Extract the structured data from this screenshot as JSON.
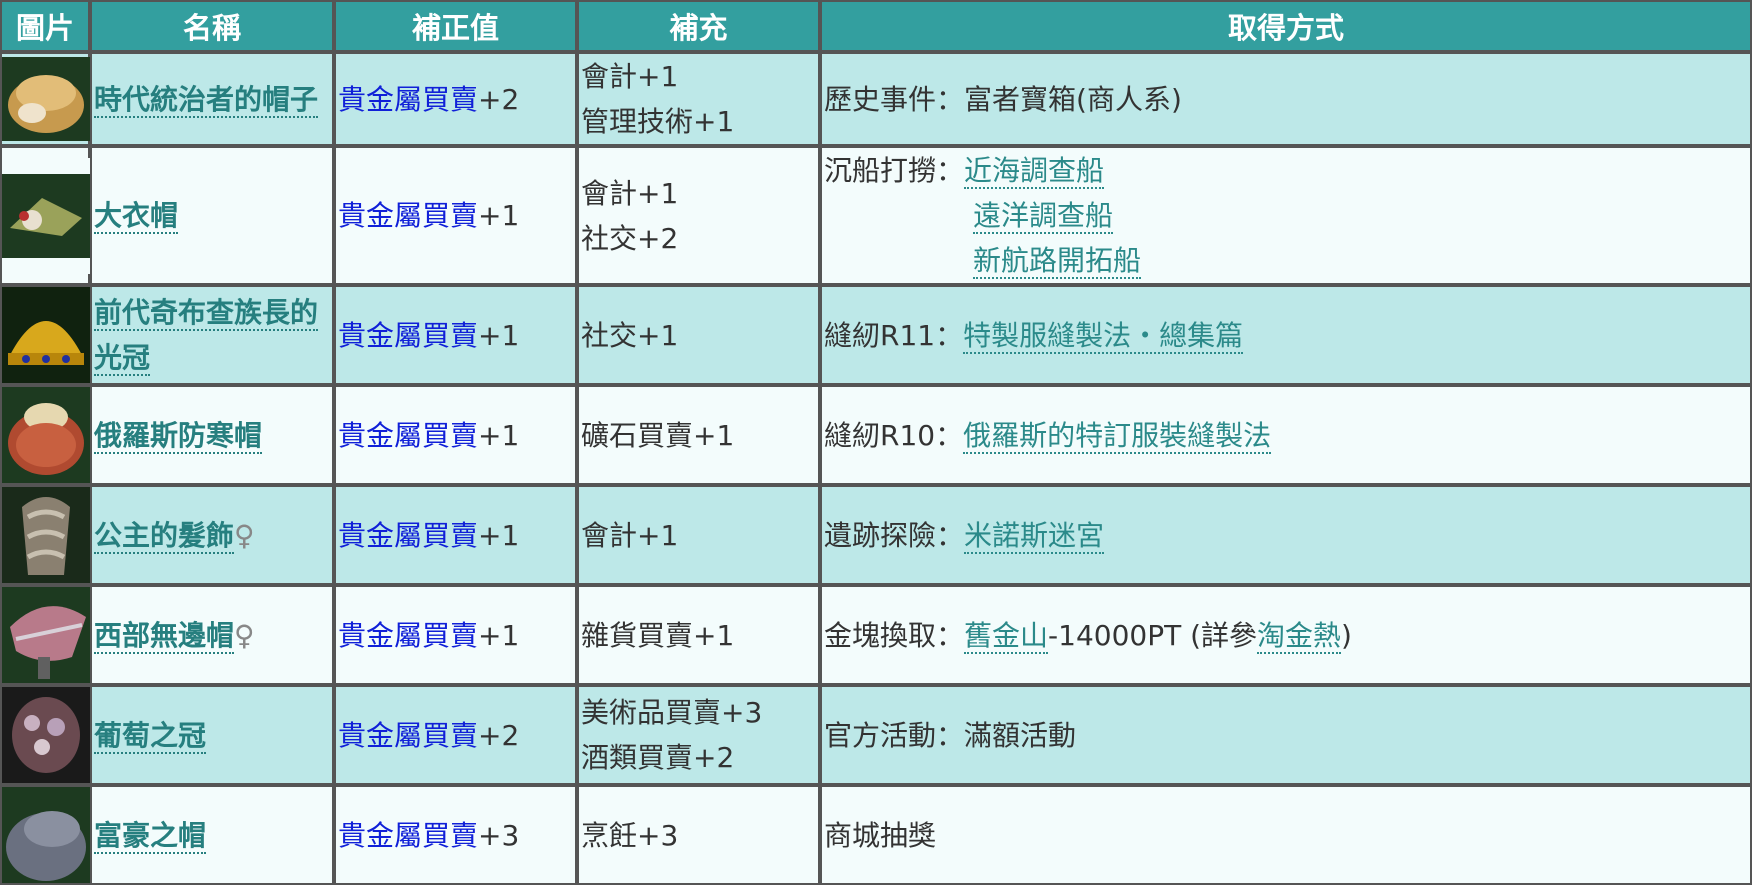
{
  "headers": {
    "image": "圖片",
    "name": "名稱",
    "bonus": "補正值",
    "extra": "補充",
    "source": "取得方式"
  },
  "colors": {
    "header": "#339f9f",
    "row_odd": "#bde8e8",
    "row_even": "#f3fcfc",
    "name_link": "#267f7f",
    "skill_link": "#1020d8"
  },
  "rows": [
    {
      "name": "時代統治者的帽子",
      "sex": "",
      "bonus_skill": "貴金屬買賣",
      "bonus_val": "+2",
      "extra": [
        "會計+1",
        "管理技術+1"
      ],
      "src_label": "歷史事件：",
      "src_text": "富者寶箱(商人系)"
    },
    {
      "name": "大衣帽",
      "sex": "",
      "bonus_skill": "貴金屬買賣",
      "bonus_val": "+1",
      "extra": [
        "會計+1",
        "社交+2"
      ],
      "src_label": "沉船打撈：",
      "src_links": [
        "近海調查船",
        "遠洋調查船",
        "新航路開拓船"
      ]
    },
    {
      "name_lines": [
        "前代奇布查族長的",
        "光冠"
      ],
      "sex": "",
      "bonus_skill": "貴金屬買賣",
      "bonus_val": "+1",
      "extra": [
        "社交+1"
      ],
      "src_label": "縫紉R11：",
      "src_link": "特製服縫製法・總集篇"
    },
    {
      "name": "俄羅斯防寒帽",
      "sex": "",
      "bonus_skill": "貴金屬買賣",
      "bonus_val": "+1",
      "extra": [
        "礦石買賣+1"
      ],
      "src_label": "縫紉R10：",
      "src_link": "俄羅斯的特訂服裝縫製法"
    },
    {
      "name": "公主的髮飾",
      "sex": "♀",
      "bonus_skill": "貴金屬買賣",
      "bonus_val": "+1",
      "extra": [
        "會計+1"
      ],
      "src_label": "遺跡探險：",
      "src_link": "米諾斯迷宮"
    },
    {
      "name": "西部無邊帽",
      "sex": "♀",
      "bonus_skill": "貴金屬買賣",
      "bonus_val": "+1",
      "extra": [
        "雜貨買賣+1"
      ],
      "src_label": "金塊換取：",
      "src_link": "舊金山",
      "src_mid": "-14000PT (詳參",
      "src_link2": "淘金熱",
      "src_end": ")"
    },
    {
      "name": "葡萄之冠",
      "sex": "",
      "bonus_skill": "貴金屬買賣",
      "bonus_val": "+2",
      "extra": [
        "美術品買賣+3",
        "酒類買賣+2"
      ],
      "src_label": "官方活動：",
      "src_text": "滿額活動"
    },
    {
      "name": "富豪之帽",
      "sex": "",
      "bonus_skill": "貴金屬買賣",
      "bonus_val": "+3",
      "extra": [
        "烹飪+3"
      ],
      "src_label": "商城抽獎",
      "src_text": ""
    }
  ]
}
